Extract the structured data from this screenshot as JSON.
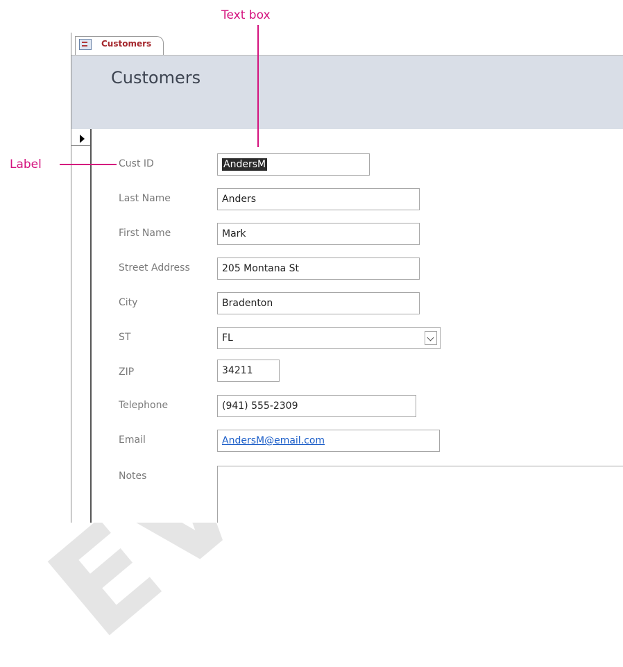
{
  "callouts": {
    "text_box": "Text box",
    "label": "Label"
  },
  "tab": {
    "label": "Customers",
    "icon": "form-icon"
  },
  "form": {
    "title": "Customers"
  },
  "fields": {
    "cust_id": {
      "label": "Cust ID",
      "value": "AndersM"
    },
    "last_name": {
      "label": "Last Name",
      "value": "Anders"
    },
    "first_name": {
      "label": "First Name",
      "value": "Mark"
    },
    "street_address": {
      "label": "Street Address",
      "value": "205 Montana St"
    },
    "city": {
      "label": "City",
      "value": "Bradenton"
    },
    "st": {
      "label": "ST",
      "value": "FL"
    },
    "zip": {
      "label": "ZIP",
      "value": "34211"
    },
    "telephone": {
      "label": "Telephone",
      "value": "(941) 555-2309"
    },
    "email": {
      "label": "Email",
      "value": "AndersM@email.com"
    },
    "notes": {
      "label": "Notes",
      "value": ""
    }
  },
  "watermark": "EVALUATION",
  "colors": {
    "callout": "#d4127e",
    "header_band": "#d9dee7",
    "tab_label": "#a4262c",
    "link": "#1a5dc8"
  }
}
